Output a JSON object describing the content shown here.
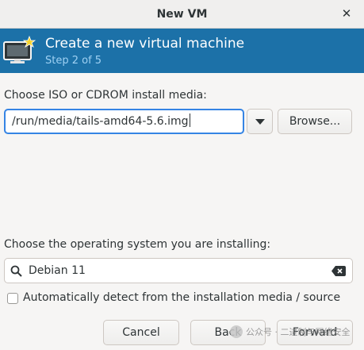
{
  "window": {
    "title": "New VM",
    "close_icon": "close-icon"
  },
  "banner": {
    "heading": "Create a new virtual machine",
    "step": "Step 2 of 5",
    "icon": "vm-monitor-icon",
    "color": "#1c71a8"
  },
  "media": {
    "label": "Choose ISO or CDROM install media:",
    "value": "/run/media/tails-amd64-5.6.img",
    "browse_label": "Browse..."
  },
  "os": {
    "label": "Choose the operating system you are installing:",
    "search_value": "Debian 11",
    "auto_detect_label": "Automatically detect from the installation media / source",
    "auto_detect_checked": false
  },
  "buttons": {
    "cancel": "Cancel",
    "back": "Back",
    "forward": "Forward"
  },
  "watermark": {
    "text": "公众号 · 二进制与网络安全"
  }
}
